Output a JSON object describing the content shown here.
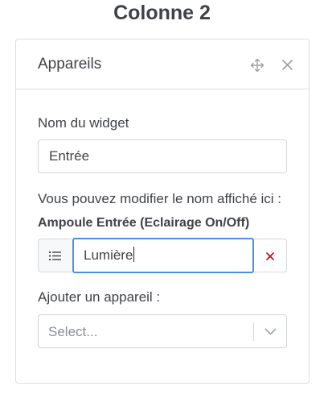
{
  "column": {
    "title": "Colonne 2"
  },
  "card": {
    "title": "Appareils",
    "icons": {
      "move": "move-icon",
      "close": "close-icon"
    }
  },
  "widget_name": {
    "label": "Nom du widget",
    "value": "Entrée"
  },
  "display_name": {
    "help_text": "Vous pouvez modifier le nom affiché ici :",
    "device_label": "Ampoule Entrée (Eclairage On/Off)",
    "value": "Lumière",
    "icons": {
      "addon": "list-icon",
      "remove": "remove-icon"
    },
    "focus_color": "#4a90e2",
    "remove_color": "#d0021b"
  },
  "add_device": {
    "label": "Ajouter un appareil :",
    "placeholder": "Select...",
    "icon": "chevron-down-icon"
  }
}
